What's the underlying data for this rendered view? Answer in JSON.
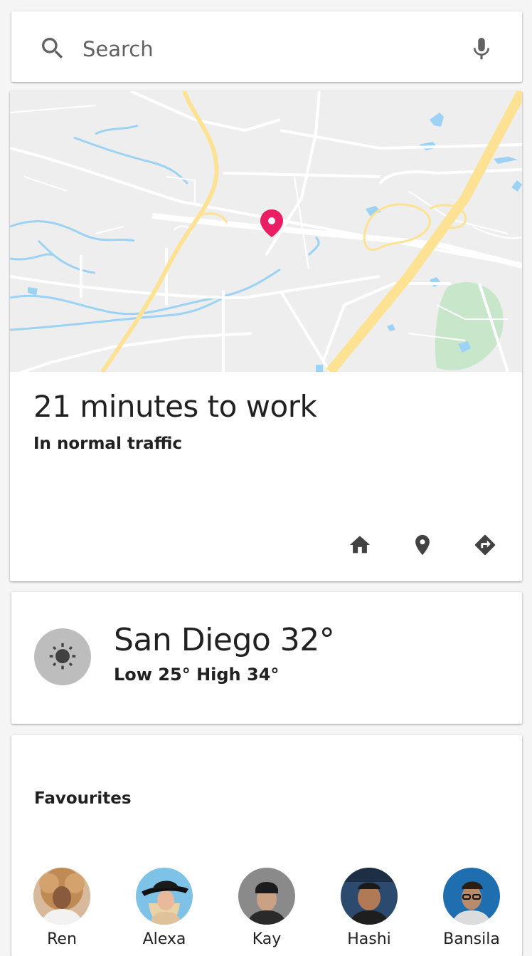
{
  "search": {
    "placeholder": "Search",
    "icon": "search-icon",
    "mic_icon": "mic-icon"
  },
  "commute": {
    "title": "21 minutes to work",
    "subtitle": "In normal traffic",
    "actions": [
      "home-icon",
      "place-icon",
      "directions-icon"
    ],
    "pin_color": "#e91e63"
  },
  "weather": {
    "title": "San Diego 32°",
    "subtitle": "Low 25° High 34°",
    "icon": "sun-icon"
  },
  "favourites": {
    "title": "Favourites",
    "people": [
      {
        "name": "Ren"
      },
      {
        "name": "Alexa"
      },
      {
        "name": "Kay"
      },
      {
        "name": "Hashi"
      },
      {
        "name": "Bansila"
      }
    ]
  },
  "colors": {
    "map_background": "#eeeeee",
    "highway": "#fde293",
    "water": "#9cd3f5",
    "park": "#c8e6c9",
    "accent": "#e91e63"
  }
}
